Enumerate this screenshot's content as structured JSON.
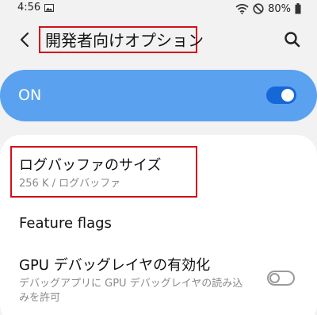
{
  "status_bar": {
    "time": "4:56",
    "battery_text": "80%",
    "icons": [
      "gallery-icon",
      "wifi-icon",
      "do-not-disturb-icon",
      "battery-icon"
    ]
  },
  "header": {
    "title": "開発者向けオプション",
    "back_icon": "back-chevron-icon",
    "search_icon": "search-icon"
  },
  "master_switch": {
    "label": "ON",
    "checked": true,
    "accent_color": "#5aa2f0",
    "toggle_color": "#1668d8"
  },
  "settings": {
    "items": [
      {
        "title": "ログバッファのサイズ",
        "summary": "256 K / ログバッファ"
      },
      {
        "title": "Feature flags",
        "summary": ""
      },
      {
        "title": "GPU デバッグレイヤの有効化",
        "summary_line1": "デバッグアプリに GPU デバッグレイヤの読み込",
        "summary_line2": "みを許可",
        "checked": false
      }
    ]
  },
  "highlight_color": "#d0101c"
}
